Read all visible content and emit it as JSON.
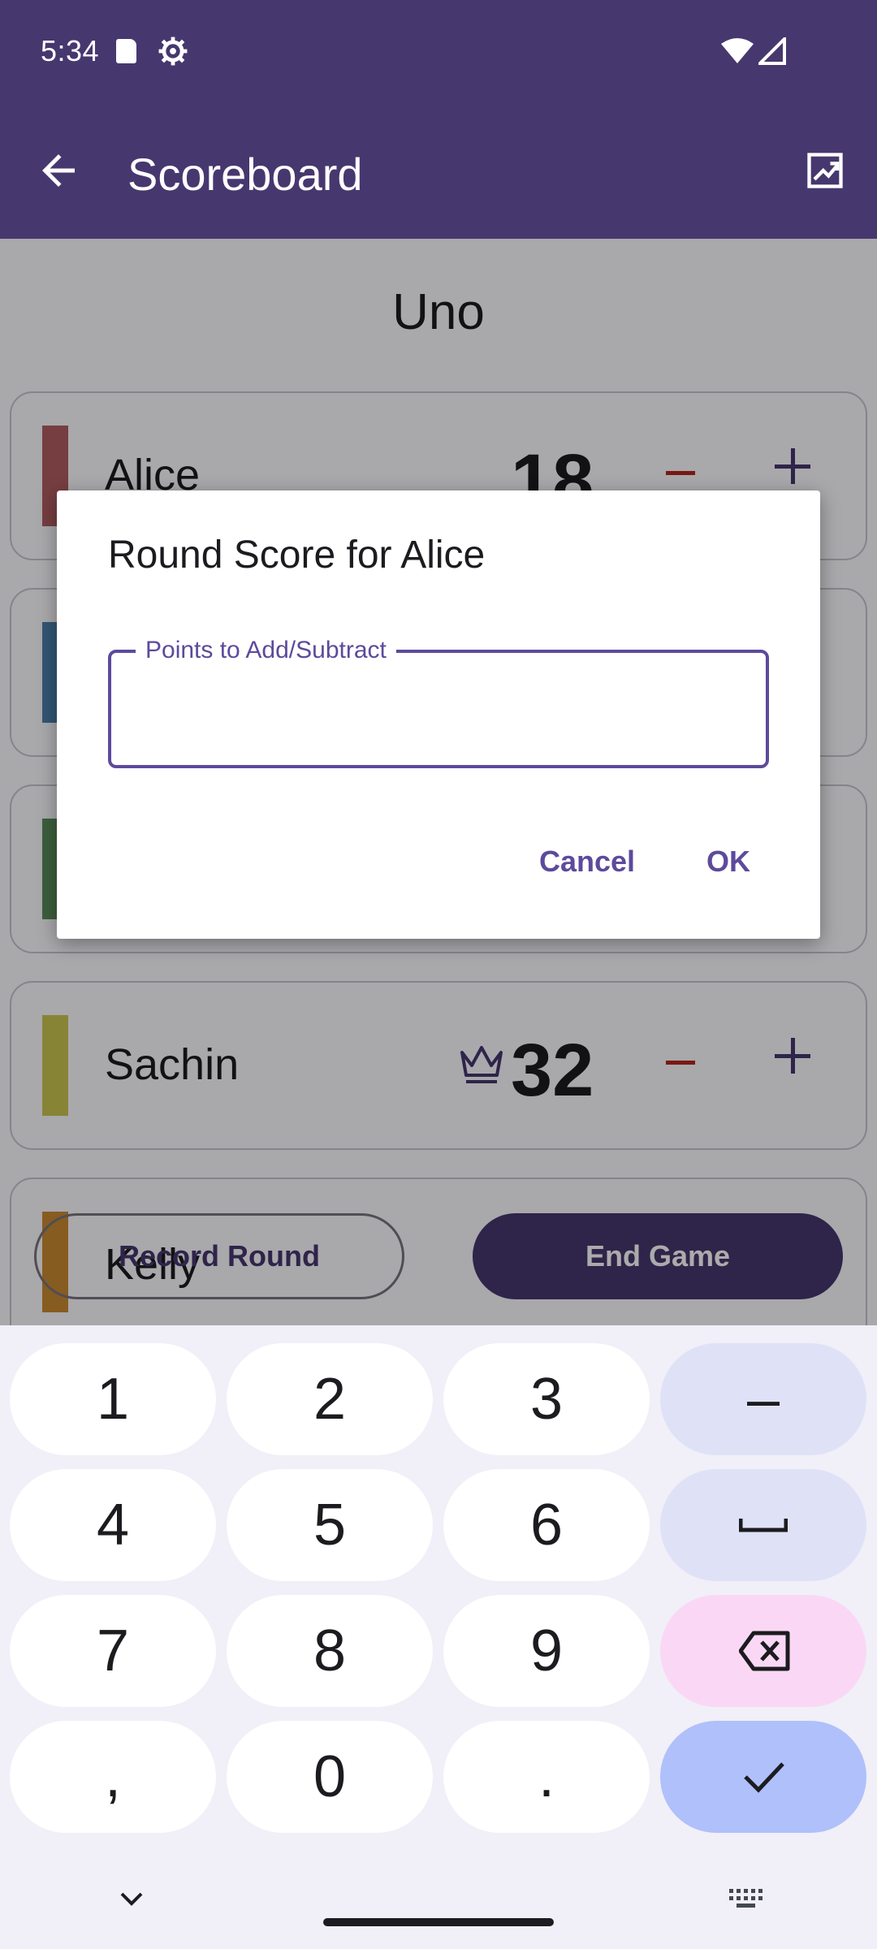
{
  "status_bar": {
    "time": "5:34"
  },
  "app_bar": {
    "title": "Scoreboard"
  },
  "game": {
    "title": "Uno"
  },
  "players": [
    {
      "name": "Alice",
      "score": "18",
      "color": "#b15d61",
      "crown": false
    },
    {
      "name": "",
      "score": "",
      "color": "#4b7fae",
      "crown": false
    },
    {
      "name": "",
      "score": "",
      "color": "#5a8e5b",
      "crown": false
    },
    {
      "name": "Sachin",
      "score": "32",
      "color": "#c9c54f",
      "crown": true
    },
    {
      "name": "Kelly",
      "score": "",
      "color": "#c98a32",
      "crown": false
    }
  ],
  "actions": {
    "record_round": "Record Round",
    "end_game": "End Game"
  },
  "dialog": {
    "title": "Round Score for Alice",
    "field_label": "Points to Add/Subtract",
    "field_value": "",
    "cancel": "Cancel",
    "ok": "OK"
  },
  "keyboard": {
    "keys": [
      "1",
      "2",
      "3",
      "–",
      "4",
      "5",
      "6",
      "␣",
      "7",
      "8",
      "9",
      "⌫",
      ",",
      "0",
      ".",
      "✓"
    ]
  },
  "colors": {
    "primary": "#47376f",
    "accent": "#5d4a9c",
    "error": "#b3261e"
  }
}
